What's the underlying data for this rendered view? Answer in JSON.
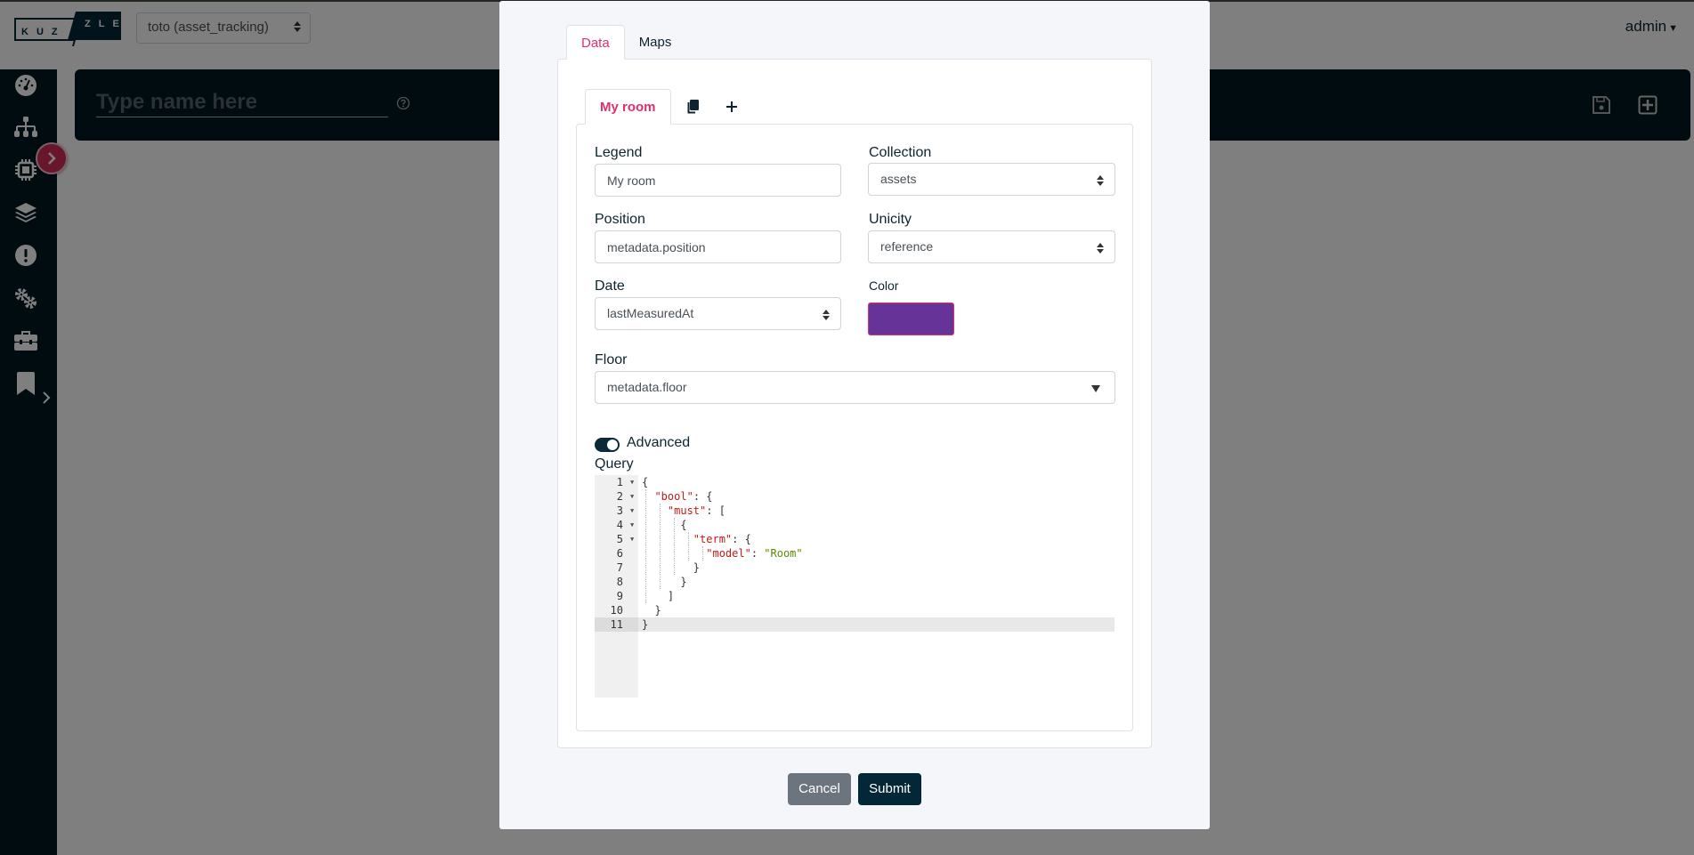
{
  "app": {
    "logo_left": "KUZ",
    "logo_right": "ZLE",
    "project_select": "toto (asset_tracking)",
    "user_menu": "admin"
  },
  "sidebar": {
    "items": [
      {
        "icon": "dashboard-gauge-icon"
      },
      {
        "icon": "sitemap-icon"
      },
      {
        "icon": "microchip-icon"
      },
      {
        "icon": "layers-icon"
      },
      {
        "icon": "alert-icon"
      },
      {
        "icon": "gears-icon"
      },
      {
        "icon": "toolbox-icon",
        "has_submenu": true
      },
      {
        "icon": "bookmark-icon"
      }
    ]
  },
  "dashboard_header": {
    "name_placeholder": "Type name here",
    "name_value": ""
  },
  "modal": {
    "tabs": [
      {
        "label": "Data",
        "active": true
      },
      {
        "label": "Maps",
        "active": false
      }
    ],
    "layer_tabs": [
      {
        "label": "My room",
        "active": true
      }
    ],
    "form": {
      "legend_label": "Legend",
      "legend_value": "My room",
      "collection_label": "Collection",
      "collection_value": "assets",
      "position_label": "Position",
      "position_value": "metadata.position",
      "unicity_label": "Unicity",
      "unicity_value": "reference",
      "date_label": "Date",
      "date_value": "lastMeasuredAt",
      "color_label": "Color",
      "color_value": "#663399",
      "floor_label": "Floor",
      "floor_value": "metadata.floor",
      "advanced_label": "Advanced",
      "advanced_enabled": true,
      "query_label": "Query"
    },
    "query_lines": [
      {
        "n": "1",
        "fold": true
      },
      {
        "n": "2",
        "fold": true
      },
      {
        "n": "3",
        "fold": true
      },
      {
        "n": "4",
        "fold": true
      },
      {
        "n": "5",
        "fold": true
      },
      {
        "n": "6",
        "fold": false
      },
      {
        "n": "7",
        "fold": false
      },
      {
        "n": "8",
        "fold": false
      },
      {
        "n": "9",
        "fold": false
      },
      {
        "n": "10",
        "fold": false
      },
      {
        "n": "11",
        "fold": false
      }
    ],
    "query_tokens": {
      "bool": "\"bool\"",
      "must": "\"must\"",
      "term": "\"term\"",
      "model": "\"model\"",
      "room": "\"Room\""
    },
    "buttons": {
      "cancel": "Cancel",
      "submit": "Submit"
    }
  },
  "colors": {
    "accent": "#e0306b",
    "dark": "#011820",
    "submit": "#022838",
    "cancel": "#6c757d"
  }
}
